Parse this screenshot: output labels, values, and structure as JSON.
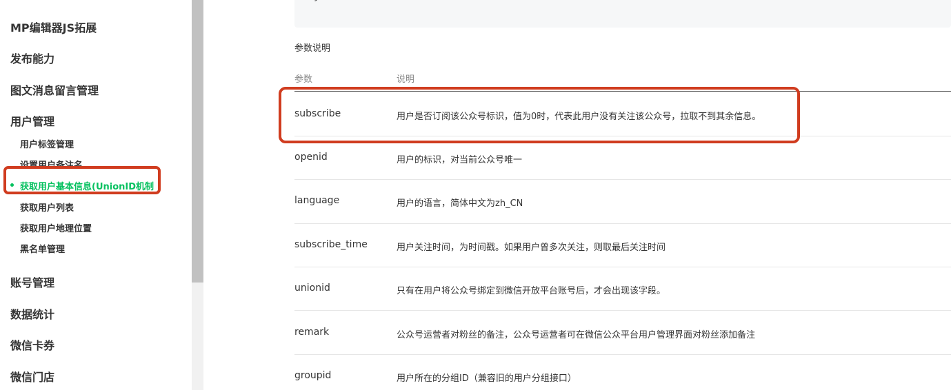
{
  "sidebar": {
    "top_items": [
      {
        "label": "MP编辑器JS拓展"
      },
      {
        "label": "发布能力"
      },
      {
        "label": "图文消息留言管理"
      },
      {
        "label": "用户管理"
      }
    ],
    "sub_items": [
      {
        "label": "用户标签管理"
      },
      {
        "label": "设置用户备注名"
      },
      {
        "label": "获取用户基本信息(UnionID机制"
      },
      {
        "label": "获取用户列表"
      },
      {
        "label": "获取用户地理位置"
      },
      {
        "label": "黑名单管理"
      }
    ],
    "bottom_items": [
      {
        "label": "账号管理"
      },
      {
        "label": "数据统计"
      },
      {
        "label": "微信卡券"
      },
      {
        "label": "微信门店"
      }
    ],
    "active_color": "#07c160"
  },
  "code": {
    "brace": "}"
  },
  "main": {
    "section_title": "参数说明",
    "headers": {
      "param": "参数",
      "desc": "说明"
    },
    "rows": [
      {
        "param": "subscribe",
        "desc": "用户是否订阅该公众号标识，值为0时，代表此用户没有关注该公众号，拉取不到其余信息。"
      },
      {
        "param": "openid",
        "desc": "用户的标识，对当前公众号唯一"
      },
      {
        "param": "language",
        "desc": "用户的语言，简体中文为zh_CN"
      },
      {
        "param": "subscribe_time",
        "desc": "用户关注时间，为时间戳。如果用户曾多次关注，则取最后关注时间"
      },
      {
        "param": "unionid",
        "desc": "只有在用户将公众号绑定到微信开放平台账号后，才会出现该字段。"
      },
      {
        "param": "remark",
        "desc": "公众号运营者对粉丝的备注，公众号运营者可在微信公众平台用户管理界面对粉丝添加备注"
      },
      {
        "param": "groupid",
        "desc": "用户所在的分组ID（兼容旧的用户分组接口）"
      }
    ]
  },
  "annotation_color": "#d03c1f"
}
